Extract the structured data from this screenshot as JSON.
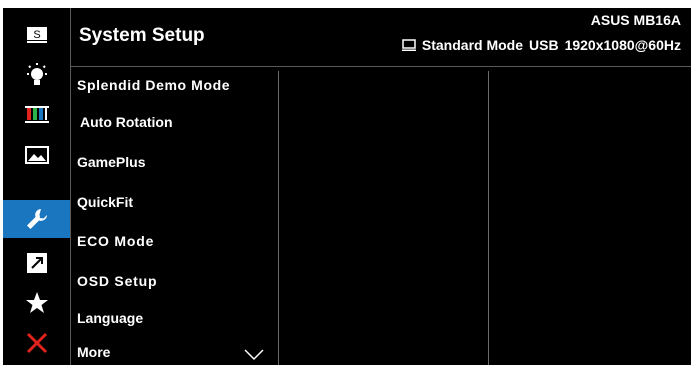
{
  "header": {
    "title": "System Setup",
    "model": "ASUS MB16A",
    "mode": "Standard Mode",
    "input": "USB",
    "resolution": "1920x1080@60Hz"
  },
  "sidebar": {
    "icons": [
      {
        "name": "splendid-s-icon",
        "active": false
      },
      {
        "name": "blue-light-filter-icon",
        "active": false
      },
      {
        "name": "color-bars-icon",
        "active": false
      },
      {
        "name": "image-icon",
        "active": false
      },
      {
        "name": "wrench-icon",
        "active": true
      },
      {
        "name": "shortcut-arrow-icon",
        "active": false
      },
      {
        "name": "star-icon",
        "active": false
      },
      {
        "name": "close-x-icon",
        "active": false
      }
    ],
    "s_icon_letter": "S"
  },
  "menu": {
    "items": [
      {
        "label": "Splendid Demo Mode"
      },
      {
        "label": "Auto Rotation"
      },
      {
        "label": "GamePlus"
      },
      {
        "label": "QuickFit"
      },
      {
        "label": "ECO Mode"
      },
      {
        "label": "OSD Setup"
      },
      {
        "label": "Language"
      },
      {
        "label": "More"
      }
    ]
  },
  "colors": {
    "background": "#000000",
    "active": "#1b76c0",
    "close": "#e0231c",
    "divider": "#5a5a5a"
  }
}
